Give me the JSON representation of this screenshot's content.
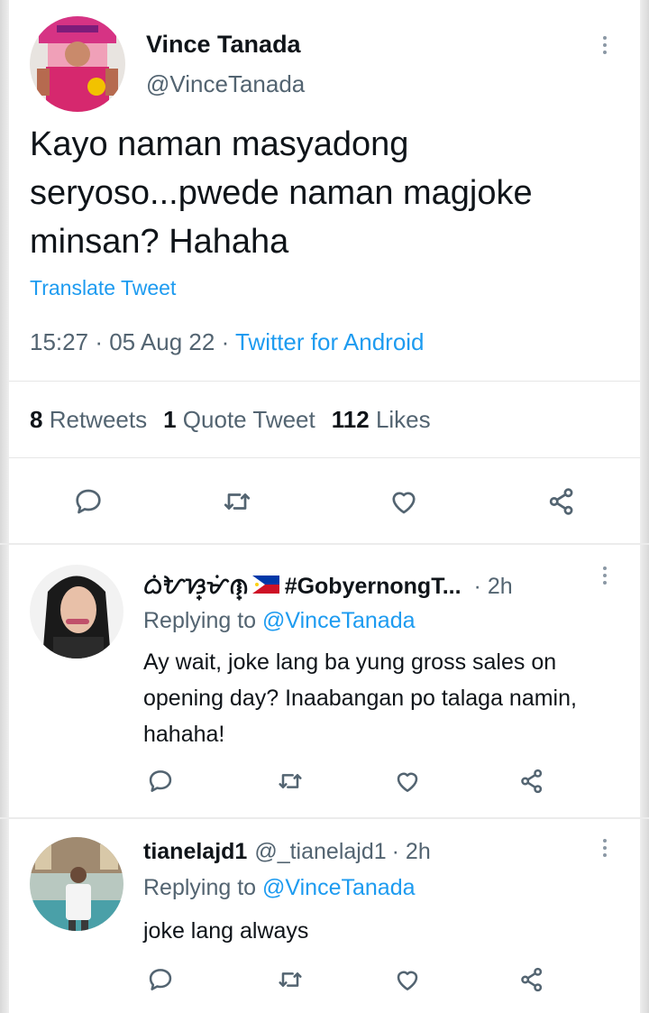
{
  "main_tweet": {
    "author_name": "Vince Tanada",
    "author_handle": "@VinceTanada",
    "text": "Kayo naman masyadong seryoso...pwede naman magjoke minsan? Hahaha",
    "translate_label": "Translate Tweet",
    "time": "15:27",
    "date": "05 Aug 22",
    "source": "Twitter for Android",
    "stats": {
      "retweets_count": "8",
      "retweets_label": "Retweets",
      "quotes_count": "1",
      "quotes_label": "Quote Tweet",
      "likes_count": "112",
      "likes_label": "Likes"
    }
  },
  "replies": [
    {
      "author_name": "ᜊᜒᜀᜐ᜔ᜋᜒᜈ᜔",
      "author_badge": "#GobyernongT...",
      "handle": "",
      "time": "· 2h",
      "replying_prefix": "Replying to",
      "replying_to": "@VinceTanada",
      "text": "Ay wait, joke lang ba yung gross sales on opening day? Inaabangan po talaga namin, hahaha!"
    },
    {
      "author_name": "tianelajd1",
      "handle": "@_tianelajd1",
      "time": "· 2h",
      "replying_prefix": "Replying to",
      "replying_to": "@VinceTanada",
      "text": "joke lang always"
    }
  ],
  "icons": {
    "reply": "reply-icon",
    "retweet": "retweet-icon",
    "like": "heart-icon",
    "share": "share-icon",
    "more": "more-icon",
    "flag": "philippines-flag-icon"
  },
  "colors": {
    "accent": "#1d9bf0",
    "secondary_text": "#536471",
    "primary_text": "#0f1419",
    "icon": "#536471"
  }
}
